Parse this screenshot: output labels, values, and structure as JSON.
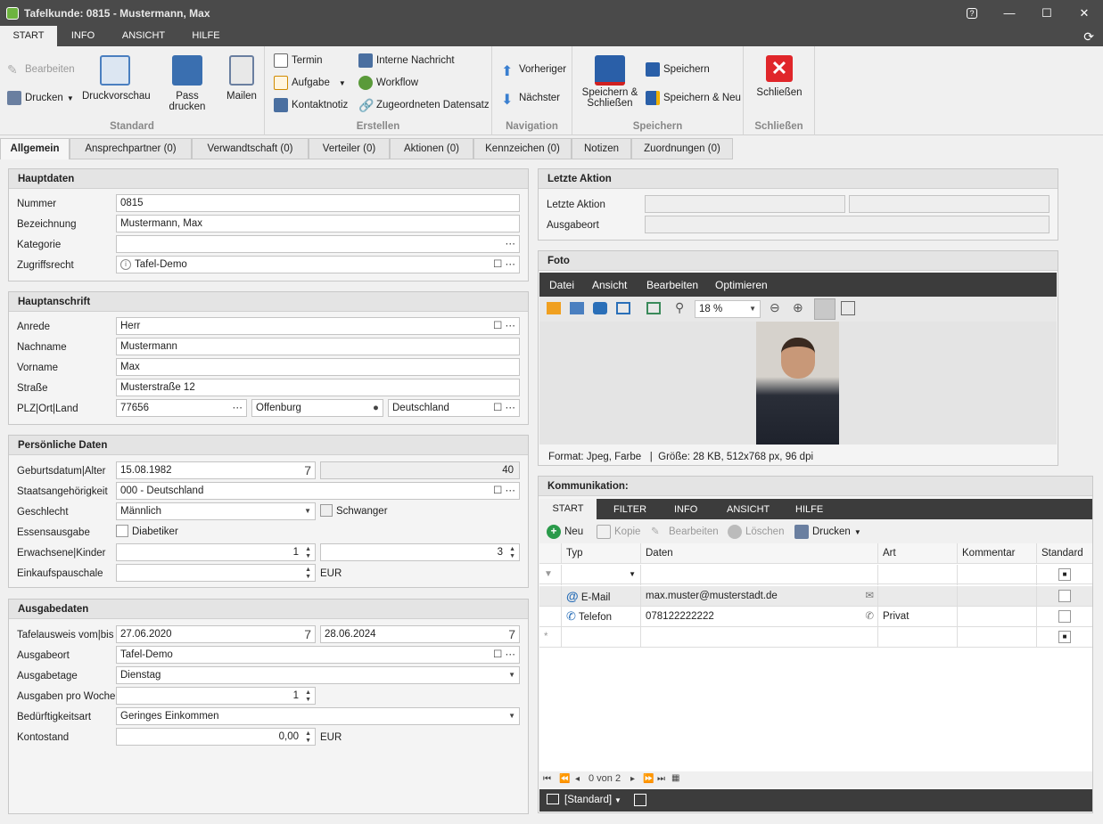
{
  "window": {
    "title": "Tafelkunde: 0815 - Mustermann, Max",
    "help": "?",
    "min": "—",
    "max": "☐",
    "close": "✕"
  },
  "menu": [
    "START",
    "INFO",
    "ANSICHT",
    "HILFE"
  ],
  "ribbon": {
    "standard": {
      "label": "Standard",
      "bearbeiten": "Bearbeiten",
      "drucken": "Drucken",
      "druckvorschau": "Druckvorschau",
      "pass_drucken": "Pass drucken",
      "mailen": "Mailen"
    },
    "erstellen": {
      "label": "Erstellen",
      "termin": "Termin",
      "aufgabe": "Aufgabe",
      "kontaktnotiz": "Kontaktnotiz",
      "interne_nachricht": "Interne Nachricht",
      "workflow": "Workflow",
      "zugeordneter": "Zugeordneten Datensatz"
    },
    "navigation": {
      "label": "Navigation",
      "vorheriger": "Vorheriger",
      "naechster": "Nächster"
    },
    "speichern": {
      "label": "Speichern",
      "speichern_schliessen_1": "Speichern &",
      "speichern_schliessen_2": "Schließen",
      "speichern": "Speichern",
      "speichern_neu": "Speichern & Neu"
    },
    "schliessen": {
      "label": "Schließen",
      "schliessen": "Schließen"
    }
  },
  "tabs": [
    "Allgemein",
    "Ansprechpartner (0)",
    "Verwandtschaft (0)",
    "Verteiler (0)",
    "Aktionen (0)",
    "Kennzeichen (0)",
    "Notizen",
    "Zuordnungen (0)"
  ],
  "hauptdaten": {
    "title": "Hauptdaten",
    "nummer_l": "Nummer",
    "nummer": "0815",
    "bez_l": "Bezeichnung",
    "bez": "Mustermann, Max",
    "kat_l": "Kategorie",
    "zugriff_l": "Zugriffsrecht",
    "zugriff": "Tafel-Demo"
  },
  "anschrift": {
    "title": "Hauptanschrift",
    "anrede_l": "Anrede",
    "anrede": "Herr",
    "nach_l": "Nachname",
    "nach": "Mustermann",
    "vor_l": "Vorname",
    "vor": "Max",
    "str_l": "Straße",
    "str": "Musterstraße 12",
    "plz_l": "PLZ|Ort|Land",
    "plz": "77656",
    "ort": "Offenburg",
    "land": "Deutschland"
  },
  "persoenlich": {
    "title": "Persönliche Daten",
    "geb_l": "Geburtsdatum|Alter",
    "geb": "15.08.1982",
    "alter": "40",
    "staat_l": "Staatsangehörigkeit",
    "staat": "000 - Deutschland",
    "geschl_l": "Geschlecht",
    "geschl": "Männlich",
    "schwanger": "Schwanger",
    "essen_l": "Essensausgabe",
    "diabetiker": "Diabetiker",
    "erw_l": "Erwachsene|Kinder",
    "erw": "1",
    "kinder": "3",
    "pausch_l": "Einkaufspauschale",
    "eur": "EUR"
  },
  "ausgabe": {
    "title": "Ausgabedaten",
    "ausweis_l": "Tafelausweis vom|bis",
    "von": "27.06.2020",
    "bis": "28.06.2024",
    "ort_l": "Ausgabeort",
    "ort": "Tafel-Demo",
    "tage_l": "Ausgabetage",
    "tage": "Dienstag",
    "woche_l": "Ausgaben pro Woche",
    "woche": "1",
    "bed_l": "Bedürftigkeitsart",
    "bed": "Geringes Einkommen",
    "konto_l": "Kontostand",
    "konto": "0,00",
    "eur": "EUR"
  },
  "letzte": {
    "title": "Letzte Aktion",
    "aktion_l": "Letzte Aktion",
    "ort_l": "Ausgabeort"
  },
  "foto": {
    "title": "Foto",
    "menu": [
      "Datei",
      "Ansicht",
      "Bearbeiten",
      "Optimieren"
    ],
    "zoom": "18 %",
    "info": "Format: Jpeg, Farbe   |  Größe: 28 KB, 512x768 px, 96 dpi"
  },
  "komm": {
    "title": "Kommunikation:",
    "menu": [
      "START",
      "FILTER",
      "INFO",
      "ANSICHT",
      "HILFE"
    ],
    "tb": {
      "neu": "Neu",
      "kopie": "Kopie",
      "bearbeiten": "Bearbeiten",
      "loeschen": "Löschen",
      "drucken": "Drucken"
    },
    "cols": [
      "Typ",
      "Daten",
      "Art",
      "Kommentar",
      "Standard"
    ],
    "rows": [
      {
        "typ": "E-Mail",
        "daten": "max.muster@musterstadt.de",
        "art": ""
      },
      {
        "typ": "Telefon",
        "daten": "078122222222",
        "art": "Privat"
      }
    ],
    "pager": "0 von 2",
    "layout": "[Standard]"
  }
}
